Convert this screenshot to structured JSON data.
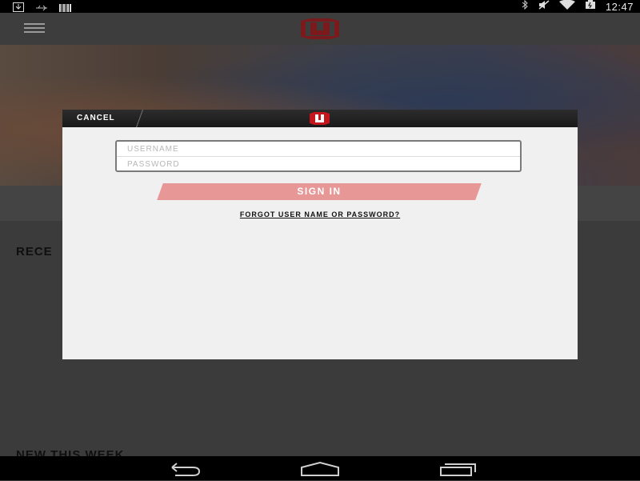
{
  "status_bar": {
    "time": "12:47",
    "left_icons": [
      "download-icon",
      "usb-icon",
      "barcode-icon"
    ],
    "right_icons": [
      "bluetooth-icon",
      "mute-icon",
      "wifi-icon",
      "battery-icon"
    ]
  },
  "app_bar": {
    "menu_icon": "hamburger-menu-icon",
    "logo_icon": "marvel-unlimited-logo-icon"
  },
  "background": {
    "section_title": "RECE",
    "section_title_2": "NEW THIS WEEK ..."
  },
  "dialog": {
    "cancel_label": "CANCEL",
    "logo_icon": "marvel-unlimited-logo-icon",
    "username_placeholder": "USERNAME",
    "password_placeholder": "PASSWORD",
    "signin_label": "SIGN IN",
    "forgot_label": "FORGOT USER NAME OR PASSWORD?"
  },
  "colors": {
    "accent": "#c4161c",
    "signin_button": "#e89797",
    "dialog_header": "#1f1f1f",
    "dialog_body": "#f0f0f0"
  },
  "nav_bar": {
    "buttons": [
      "back-icon",
      "home-icon",
      "recent-apps-icon"
    ]
  }
}
